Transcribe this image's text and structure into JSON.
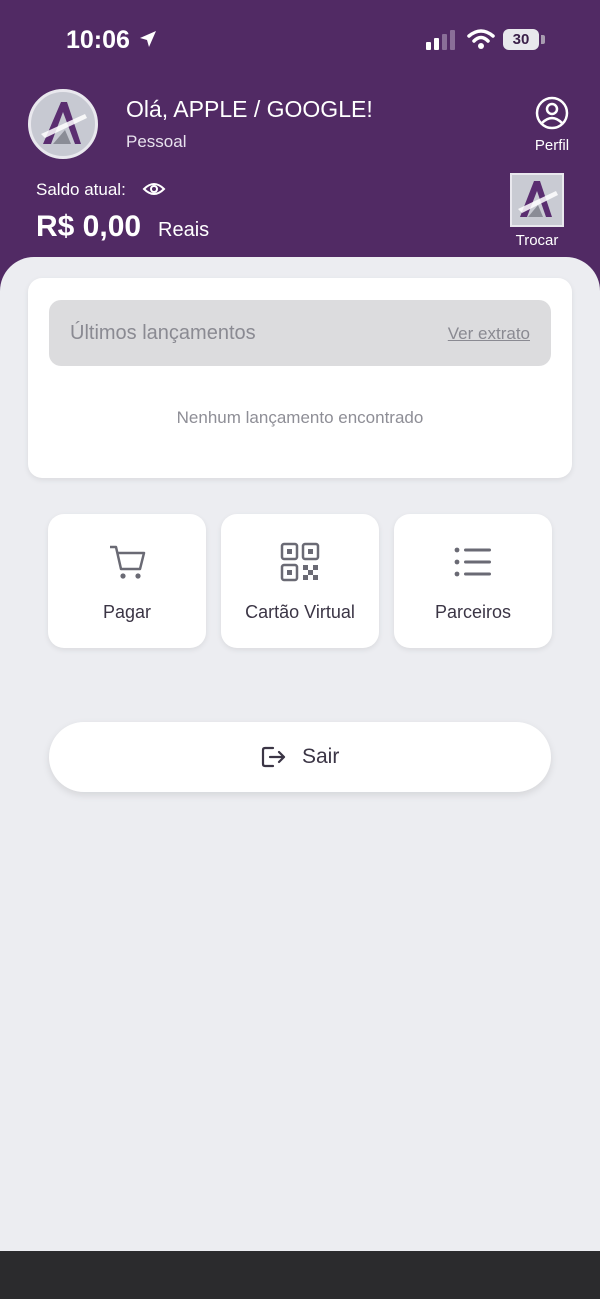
{
  "status_bar": {
    "time": "10:06",
    "battery": "30"
  },
  "header": {
    "greeting": "Olá, APPLE / GOOGLE!",
    "account_type": "Pessoal",
    "profile_label": "Perfil",
    "balance_label": "Saldo atual:",
    "balance_value": "R$ 0,00",
    "balance_unit": "Reais",
    "switch_label": "Trocar"
  },
  "recent": {
    "title": "Últimos lançamentos",
    "statement_link": "Ver extrato",
    "empty_message": "Nenhum lançamento encontrado"
  },
  "actions": [
    {
      "label": "Pagar",
      "icon": "cart-icon"
    },
    {
      "label": "Cartão Virtual",
      "icon": "qr-code-icon"
    },
    {
      "label": "Parceiros",
      "icon": "list-icon"
    }
  ],
  "logout": {
    "label": "Sair",
    "icon": "logout-icon"
  },
  "colors": {
    "header": "#512a64",
    "background": "#ecedf1",
    "text_dark": "#3b3545",
    "icon_gray": "#6a6a74"
  }
}
